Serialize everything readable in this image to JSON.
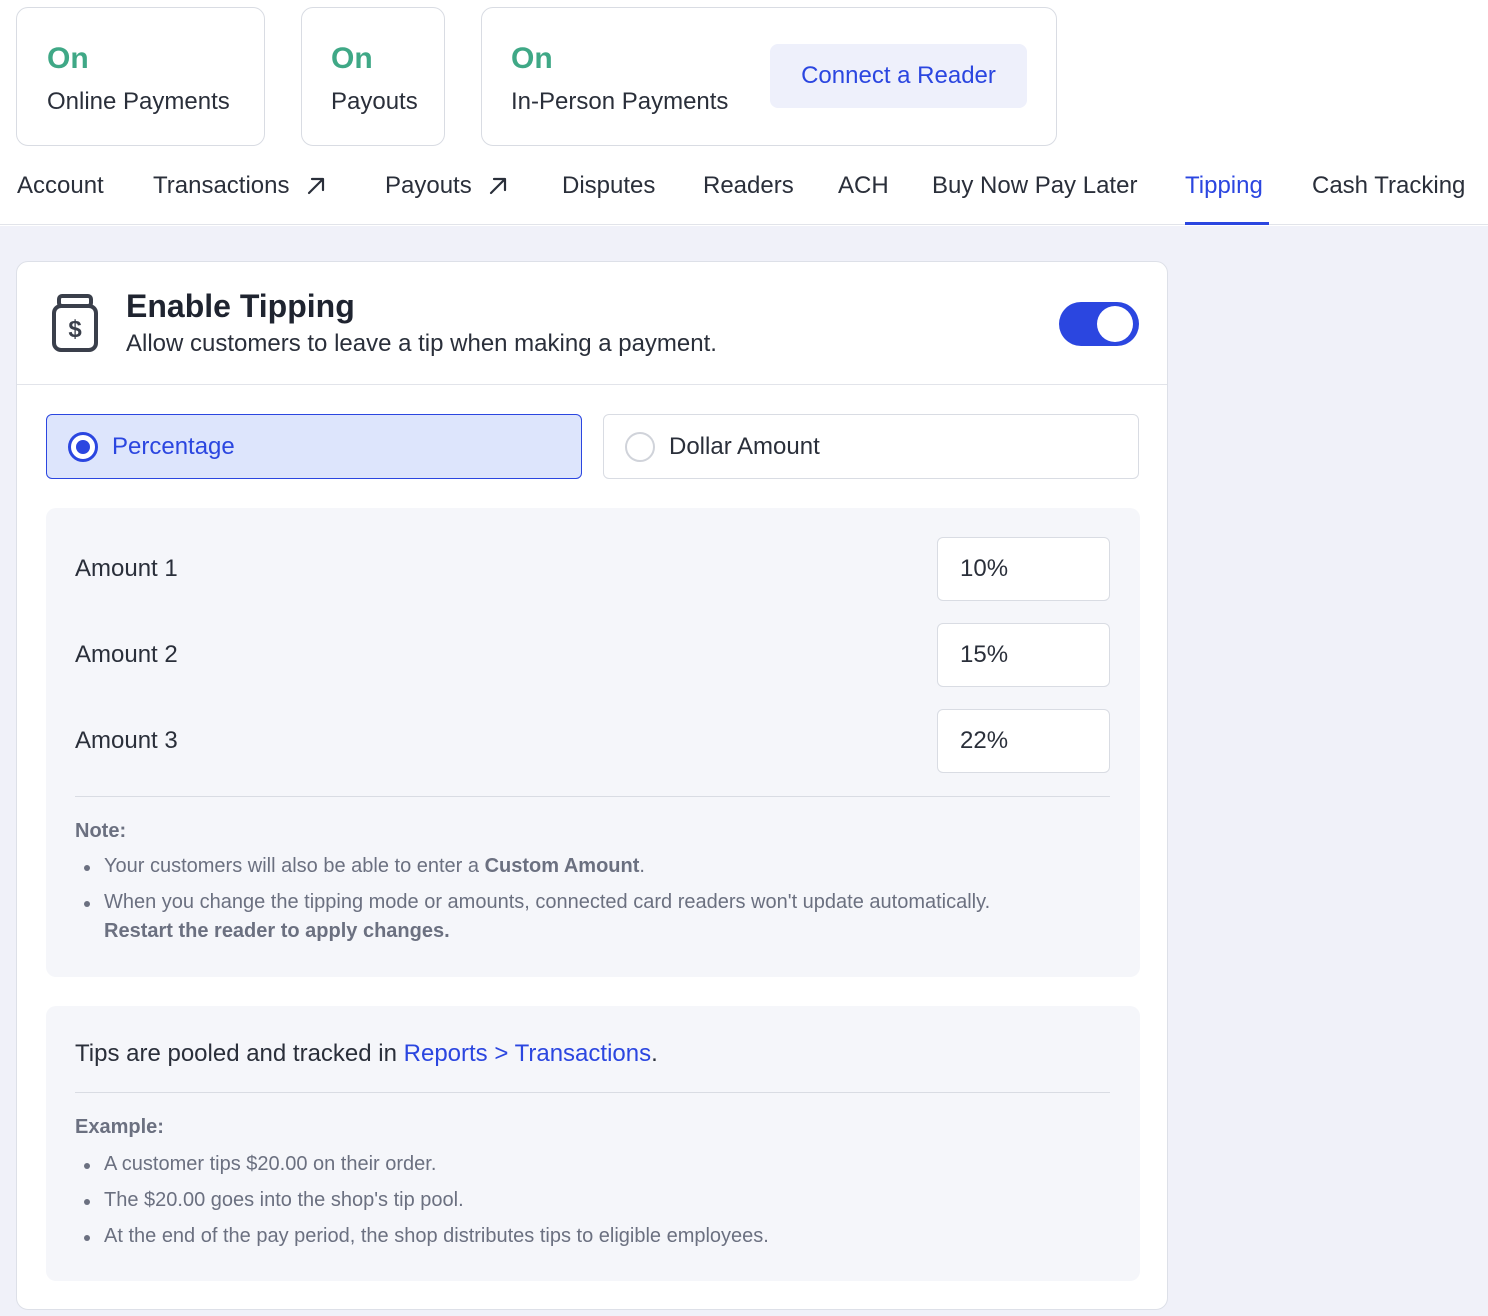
{
  "status_cards": [
    {
      "status": "On",
      "label": "Online Payments"
    },
    {
      "status": "On",
      "label": "Payouts"
    },
    {
      "status": "On",
      "label": "In-Person Payments"
    }
  ],
  "connect_reader_label": "Connect a Reader",
  "tabs": [
    {
      "label": "Account",
      "external": false
    },
    {
      "label": "Transactions",
      "external": true
    },
    {
      "label": "Payouts",
      "external": true
    },
    {
      "label": "Disputes",
      "external": false
    },
    {
      "label": "Readers",
      "external": false
    },
    {
      "label": "ACH",
      "external": false
    },
    {
      "label": "Buy Now Pay Later",
      "external": false
    },
    {
      "label": "Tipping",
      "external": false,
      "active": true
    },
    {
      "label": "Cash Tracking",
      "external": false
    }
  ],
  "tipping": {
    "title": "Enable Tipping",
    "subtitle": "Allow customers to leave a tip when making a payment.",
    "enabled": true,
    "icon": "tip-jar-icon",
    "mode_options": [
      {
        "label": "Percentage",
        "selected": true
      },
      {
        "label": "Dollar Amount",
        "selected": false
      }
    ],
    "amounts": [
      {
        "label": "Amount 1",
        "value": "10%"
      },
      {
        "label": "Amount 2",
        "value": "15%"
      },
      {
        "label": "Amount 3",
        "value": "22%"
      }
    ],
    "note": {
      "title": "Note:",
      "item1_prefix": "Your customers will also be able to enter a ",
      "item1_bold": "Custom Amount",
      "item1_suffix": ".",
      "item2_text": "When you change the tipping mode or amounts, connected card readers won't update automatically.",
      "item2_bold": "Restart the reader to apply changes."
    },
    "pool": {
      "prefix": "Tips are pooled and tracked in ",
      "link": "Reports > Transactions",
      "suffix": ".",
      "example_title": "Example:",
      "example_items": [
        "A customer tips $20.00 on their order.",
        "The $20.00 goes into the shop's tip pool.",
        "At the end of the pay period, the shop distributes tips to eligible employees."
      ]
    }
  },
  "colors": {
    "accent": "#2b46e0",
    "status_on": "#3fa886",
    "page_bg": "#f0f1f9"
  }
}
